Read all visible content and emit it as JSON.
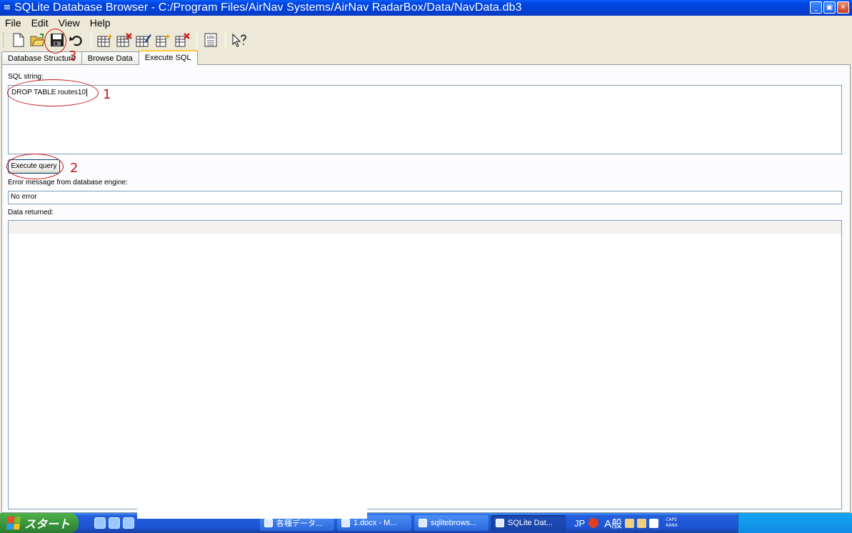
{
  "window": {
    "title": "SQLite Database Browser - C:/Program Files/AirNav Systems/AirNav RadarBox/Data/NavData.db3",
    "controls": [
      "minimize",
      "maximize",
      "close"
    ]
  },
  "menu": [
    "File",
    "Edit",
    "View",
    "Help"
  ],
  "toolbar": {
    "buttons": [
      "new-database-icon",
      "open-database-icon",
      "save-icon",
      "undo-icon",
      "create-table-icon",
      "delete-table-icon",
      "modify-table-icon",
      "create-index-icon",
      "delete-index-icon",
      "log-icon",
      "whats-this-icon"
    ],
    "log_label": "LOG"
  },
  "tabs": [
    "Database Structure",
    "Browse Data",
    "Execute SQL"
  ],
  "active_tab": "Execute SQL",
  "sql": {
    "label": "SQL string:",
    "value": "DROP TABLE routes10"
  },
  "execute_button": "Execute query",
  "error": {
    "label": "Error message from database engine:",
    "value": "No error"
  },
  "data_returned_label": "Data returned:",
  "annotations": {
    "marks": [
      "1",
      "2",
      "3"
    ],
    "color": "#c81414"
  },
  "taskbar": {
    "start_label": "スタート",
    "tasks": [
      "各種データ...",
      "1.docx - M...",
      "sqlitebrows...",
      "SQLite Dat..."
    ],
    "language": "JP",
    "ime": "A般",
    "caps": "CAPS",
    "kana": "KANA"
  }
}
